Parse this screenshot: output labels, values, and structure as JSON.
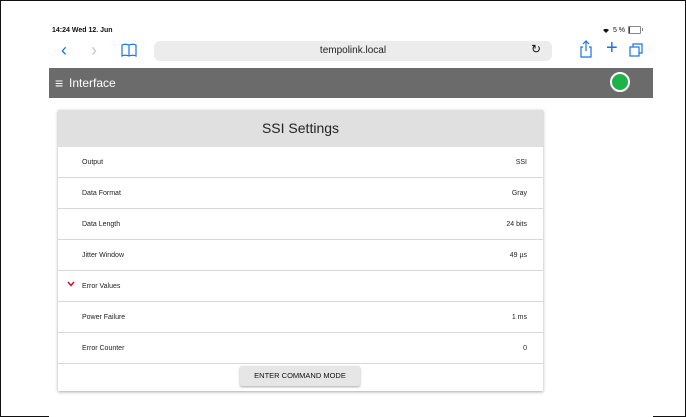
{
  "status_bar": {
    "time": "14:24  Wed 12. Jun",
    "battery": "5 %",
    "battery_level": 0.05
  },
  "browser": {
    "url": "tempolink.local"
  },
  "app_bar": {
    "title": "Interface",
    "status_color": "#1db348"
  },
  "card": {
    "title": "SSI Settings",
    "rows": [
      {
        "label": "Output",
        "value": "SSI"
      },
      {
        "label": "Data Format",
        "value": "Gray"
      },
      {
        "label": "Data Length",
        "value": "24 bits"
      },
      {
        "label": "Jitter Window",
        "value": "49 µs"
      },
      {
        "label": "Error Values",
        "value": ""
      },
      {
        "label": "Power Failure",
        "value": "1 ms"
      },
      {
        "label": "Error Counter",
        "value": "0"
      }
    ],
    "command_button": "ENTER COMMAND MODE"
  }
}
